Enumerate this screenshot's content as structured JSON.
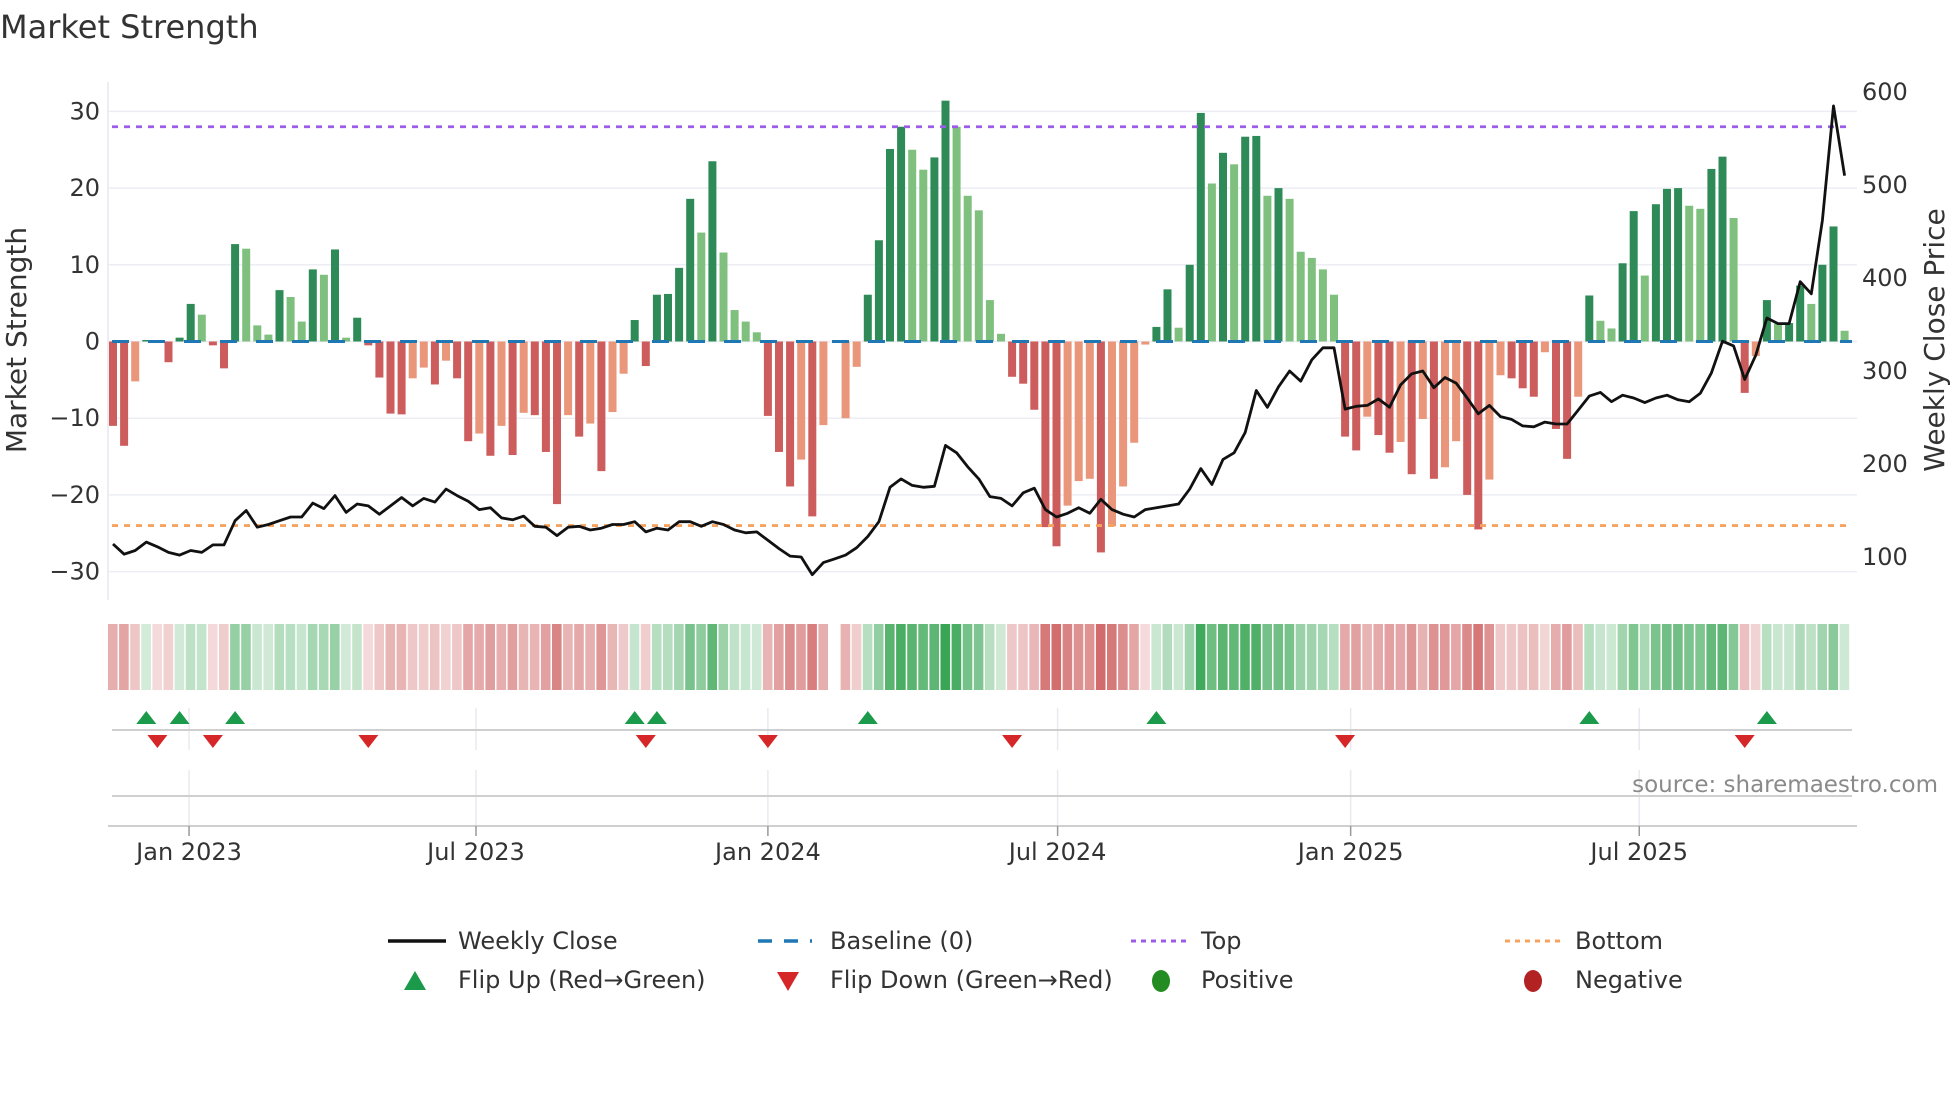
{
  "title": "Market Strength",
  "source": "source: sharemaestro.com",
  "colors": {
    "rising_positive": "#2e8b57",
    "falling_positive": "#7fc07f",
    "falling_negative": "#cd5c5c",
    "rising_negative": "#e9967a",
    "weekly_close": "#111111",
    "baseline": "#1f77b4",
    "top": "#9b5de5",
    "bottom": "#f4a460",
    "flip_up": "#1a9a4a",
    "flip_down": "#d62728",
    "positive": "#228b22",
    "negative": "#b22222",
    "strip_green": "#3aa655",
    "strip_red": "#cd5c5c"
  },
  "legend": [
    {
      "key": "weekly_close",
      "label": "Weekly Close",
      "symbol": "line-solid"
    },
    {
      "key": "baseline",
      "label": "Baseline (0)",
      "symbol": "line-dashed"
    },
    {
      "key": "top",
      "label": "Top",
      "symbol": "line-dotted"
    },
    {
      "key": "bottom",
      "label": "Bottom",
      "symbol": "line-dotted"
    },
    {
      "key": "flip_up",
      "label": "Flip Up (Red→Green)",
      "symbol": "triangle-up"
    },
    {
      "key": "flip_down",
      "label": "Flip Down (Green→Red)",
      "symbol": "triangle-down"
    },
    {
      "key": "positive",
      "label": "Positive",
      "symbol": "circle"
    },
    {
      "key": "negative",
      "label": "Negative",
      "symbol": "circle"
    }
  ],
  "chart_data": {
    "type": "bar",
    "title": "Market Strength",
    "ylabel": "Market Strength",
    "y2label": "Weekly Close Price",
    "ylim": [
      -34,
      35
    ],
    "y2lim": [
      100,
      600
    ],
    "y_ticks": [
      {
        "v": 30,
        "label": "30"
      },
      {
        "v": 20,
        "label": "20"
      },
      {
        "v": 10,
        "label": "10"
      },
      {
        "v": 0,
        "label": "0"
      },
      {
        "v": -10,
        "label": "−10"
      },
      {
        "v": -20,
        "label": "−20"
      },
      {
        "v": -30,
        "label": "−30"
      }
    ],
    "y2_ticks": [
      {
        "v": 600,
        "label": "600"
      },
      {
        "v": 500,
        "label": "500"
      },
      {
        "v": 400,
        "label": "400"
      },
      {
        "v": 300,
        "label": "300"
      },
      {
        "v": 200,
        "label": "200"
      },
      {
        "v": 100,
        "label": "100"
      }
    ],
    "x_ticks": [
      {
        "week": 6.85,
        "label": "Jan 2023"
      },
      {
        "week": 32.7,
        "label": "Jul 2023"
      },
      {
        "week": 59,
        "label": "Jan 2024"
      },
      {
        "week": 85.1,
        "label": "Jul 2024"
      },
      {
        "week": 111.5,
        "label": "Jan 2025"
      },
      {
        "week": 137.5,
        "label": "Jul 2025"
      }
    ],
    "top_level": 28,
    "bottom_level": -24,
    "baseline": 0,
    "grid": true,
    "legend_position": "bottom",
    "strength": [
      -11,
      -13.6,
      -5.2,
      0.2,
      -0.2,
      -2.7,
      0.5,
      4.9,
      3.5,
      -0.5,
      -3.5,
      12.7,
      12.1,
      2.1,
      0.9,
      6.7,
      5.8,
      2.6,
      9.4,
      8.7,
      12,
      0.5,
      3.1,
      -0.5,
      -4.7,
      -9.4,
      -9.5,
      -4.8,
      -3.4,
      -5.6,
      -2.5,
      -4.8,
      -13,
      -12,
      -14.9,
      -11,
      -14.8,
      -9.3,
      -9.6,
      -14.4,
      -21.2,
      -9.6,
      -12.4,
      -10.7,
      -16.9,
      -9.2,
      -4.2,
      2.8,
      -3.2,
      6.1,
      6.2,
      9.6,
      18.6,
      14.2,
      23.5,
      11.6,
      4.1,
      2.6,
      1.2,
      -9.7,
      -14.4,
      -18.9,
      -15.4,
      -22.8,
      -10.9,
      null,
      -10,
      -3.3,
      6.1,
      13.2,
      25.1,
      28,
      25,
      22.4,
      24,
      31.4,
      28,
      19,
      17.1,
      5.4,
      1,
      -4.6,
      -5.5,
      -8.9,
      -24.2,
      -26.7,
      -21.4,
      -18.2,
      -17.9,
      -27.5,
      -24.1,
      -18.9,
      -13.2,
      -0.4,
      1.9,
      6.8,
      1.8,
      10,
      29.8,
      20.6,
      24.6,
      23.1,
      26.7,
      26.8,
      19,
      20,
      18.6,
      11.7,
      10.9,
      9.4,
      6.1,
      -12.4,
      -14.2,
      -9.8,
      -12.2,
      -14.5,
      -13.1,
      -17.3,
      -10.1,
      -17.9,
      -16.4,
      -13,
      -20,
      -24.5,
      -18,
      -4.4,
      -4.8,
      -6.1,
      -7.2,
      -1.4,
      -11.4,
      -15.3,
      -7.2,
      6,
      2.7,
      1.7,
      10.2,
      17,
      8.6,
      17.9,
      19.9,
      20,
      17.7,
      17.3,
      22.5,
      24.1,
      16.1,
      -6.7,
      -1.9,
      5.4,
      2.3,
      2.4,
      7.3,
      4.9,
      10,
      15,
      1.4
    ],
    "weekly_close": [
      114,
      103,
      107,
      116,
      111,
      105,
      102,
      107,
      105,
      113,
      113,
      139,
      150,
      132,
      135,
      139,
      143,
      143,
      158,
      152,
      166,
      148,
      157,
      155,
      146,
      155,
      164,
      155,
      163,
      159,
      173,
      166,
      160,
      151,
      153,
      142,
      140,
      144,
      133,
      132,
      123,
      132,
      133,
      129,
      131,
      135,
      135,
      138,
      127,
      131,
      129,
      138,
      138,
      133,
      138,
      135,
      129,
      126,
      127,
      118,
      109,
      101,
      100,
      81,
      94,
      98,
      102,
      110,
      122,
      138,
      175,
      184,
      177,
      175,
      176,
      220,
      212,
      197,
      184,
      165,
      163,
      155,
      169,
      174,
      151,
      143,
      147,
      153,
      147,
      162,
      151,
      146,
      143,
      151,
      153,
      155,
      157,
      173,
      195,
      178,
      205,
      212,
      234,
      279,
      261,
      283,
      300,
      289,
      312,
      325,
      325,
      259,
      262,
      263,
      270,
      261,
      285,
      297,
      300,
      282,
      293,
      287,
      271,
      254,
      263,
      251,
      248,
      241,
      240,
      245,
      243,
      243,
      258,
      273,
      277,
      267,
      274,
      271,
      266,
      271,
      274,
      269,
      267,
      276,
      298,
      332,
      327,
      291,
      317,
      357,
      351,
      351,
      396,
      383,
      462,
      585,
      510
    ],
    "flip_up_weeks": [
      3,
      6,
      11,
      47,
      49,
      68,
      94,
      133,
      149
    ],
    "flip_down_weeks": [
      4,
      9,
      23,
      48,
      59,
      81,
      111,
      147
    ]
  }
}
